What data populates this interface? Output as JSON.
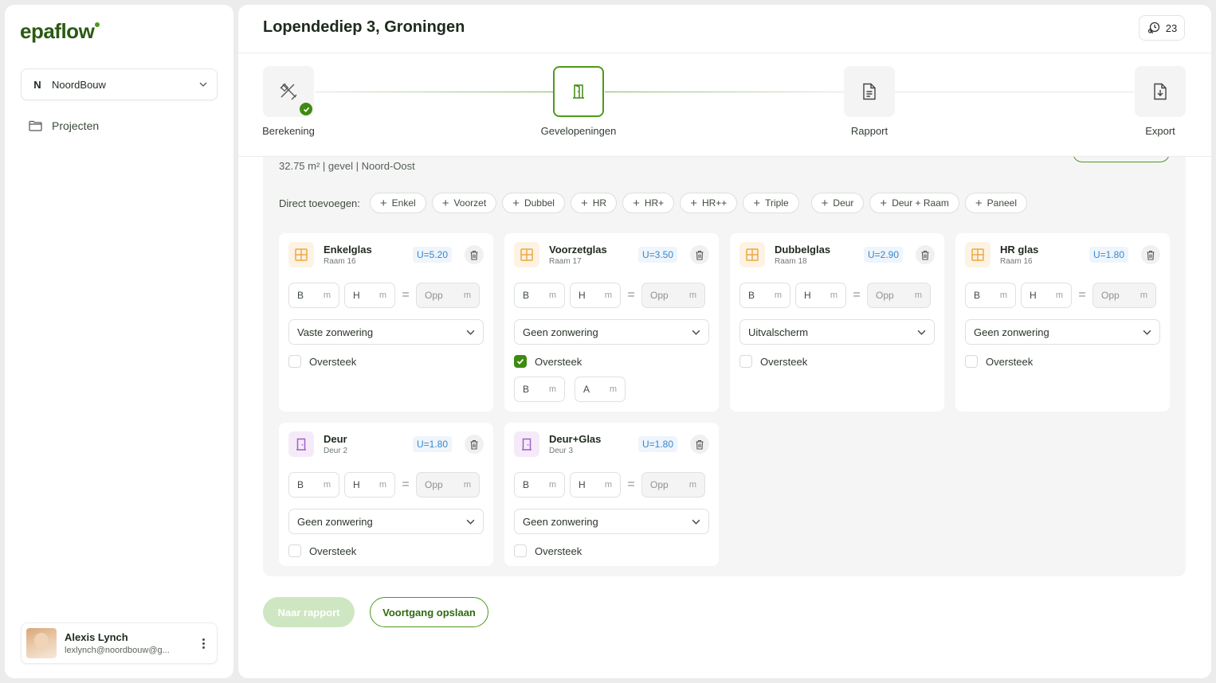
{
  "brand": {
    "name": "epaflow"
  },
  "sidebar": {
    "org": {
      "initial": "N",
      "name": "NoordBouw"
    },
    "nav": [
      {
        "label": "Projecten"
      }
    ],
    "user": {
      "name": "Alexis Lynch",
      "email": "lexlynch@noordbouw@g..."
    }
  },
  "header": {
    "title": "Lopendediep 3, Groningen",
    "notifications": "23"
  },
  "stepper": {
    "steps": [
      {
        "label": "Berekening",
        "state": "done"
      },
      {
        "label": "Gevelopeningen",
        "state": "active"
      },
      {
        "label": "Rapport",
        "state": "pending"
      },
      {
        "label": "Export",
        "state": "pending"
      }
    ]
  },
  "facade": {
    "meta": "32.75 m² | gevel | Noord-Oost"
  },
  "direct_add": {
    "label": "Direct toevoegen:",
    "chips": [
      "Enkel",
      "Voorzet",
      "Dubbel",
      "HR",
      "HR+",
      "HR++",
      "Triple",
      "Deur",
      "Deur + Raam",
      "Paneel"
    ]
  },
  "fields": {
    "width": "B",
    "height": "H",
    "area": "Opp",
    "unit": "m",
    "overhang_a": "A",
    "overhang_label": "Oversteek"
  },
  "openings": [
    {
      "title": "Enkelglas",
      "sub": "Raam 16",
      "u": "U=5.20",
      "shading": "Vaste zonwering",
      "overhang": false,
      "kind": "window"
    },
    {
      "title": "Voorzetglas",
      "sub": "Raam 17",
      "u": "U=3.50",
      "shading": "Geen zonwering",
      "overhang": true,
      "kind": "window"
    },
    {
      "title": "Dubbelglas",
      "sub": "Raam 18",
      "u": "U=2.90",
      "shading": "Uitvalscherm",
      "overhang": false,
      "kind": "window"
    },
    {
      "title": "HR glas",
      "sub": "Raam 16",
      "u": "U=1.80",
      "shading": "Geen zonwering",
      "overhang": false,
      "kind": "window"
    },
    {
      "title": "Deur",
      "sub": "Deur 2",
      "u": "U=1.80",
      "shading": "Geen zonwering",
      "overhang": false,
      "kind": "door"
    },
    {
      "title": "Deur+Glas",
      "sub": "Deur 3",
      "u": "U=1.80",
      "shading": "Geen zonwering",
      "overhang": false,
      "kind": "door"
    }
  ],
  "footer": {
    "primary": "Naar rapport",
    "secondary": "Voortgang opslaan"
  },
  "colors": {
    "brand_green": "#4e9a1a",
    "dark_green": "#2a5a12",
    "u_blue": "#3a86c8",
    "window_orange": "#f0a640",
    "door_purple": "#a45ec8"
  }
}
